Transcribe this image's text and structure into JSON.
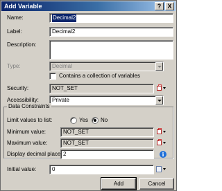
{
  "window": {
    "title": "Add Variable",
    "help_glyph": "?",
    "close_glyph": "X"
  },
  "form": {
    "name_label": "Name:",
    "name_value": "Decimal2",
    "label_label": "Label:",
    "label_value": "Decimal2",
    "description_label": "Description:",
    "description_value": "",
    "type_label": "Type:",
    "type_value": "Decimal",
    "collection_label": "Contains a collection of variables",
    "collection_checked": false,
    "security_label": "Security:",
    "security_value": "NOT_SET",
    "accessibility_label": "Accessibility:",
    "accessibility_value": "Private",
    "initial_label": "Initial value:",
    "initial_value": "0"
  },
  "constraints": {
    "group_title": "Data Constraints",
    "limit_label": "Limit values to list:",
    "yes_label": "Yes",
    "no_label": "No",
    "selected": "No",
    "min_label": "Minimum value:",
    "min_value": "NOT_SET",
    "max_label": "Maximum value:",
    "max_value": "NOT_SET",
    "decimals_label": "Display decimal places:",
    "decimals_value": "2"
  },
  "buttons": {
    "add": "Add",
    "cancel": "Cancel"
  },
  "colors": {
    "title_gradient_start": "#0a246a",
    "dialog_bg": "#d4d0c8",
    "selection": "#0a246a",
    "info_icon": "#1e6fd9"
  },
  "icons": {
    "security_picker": "security-picker-icon",
    "min_picker": "min-value-picker-icon",
    "max_picker": "max-value-picker-icon",
    "decimals_info": "info-icon",
    "initial_expression": "expression-editor-icon"
  }
}
